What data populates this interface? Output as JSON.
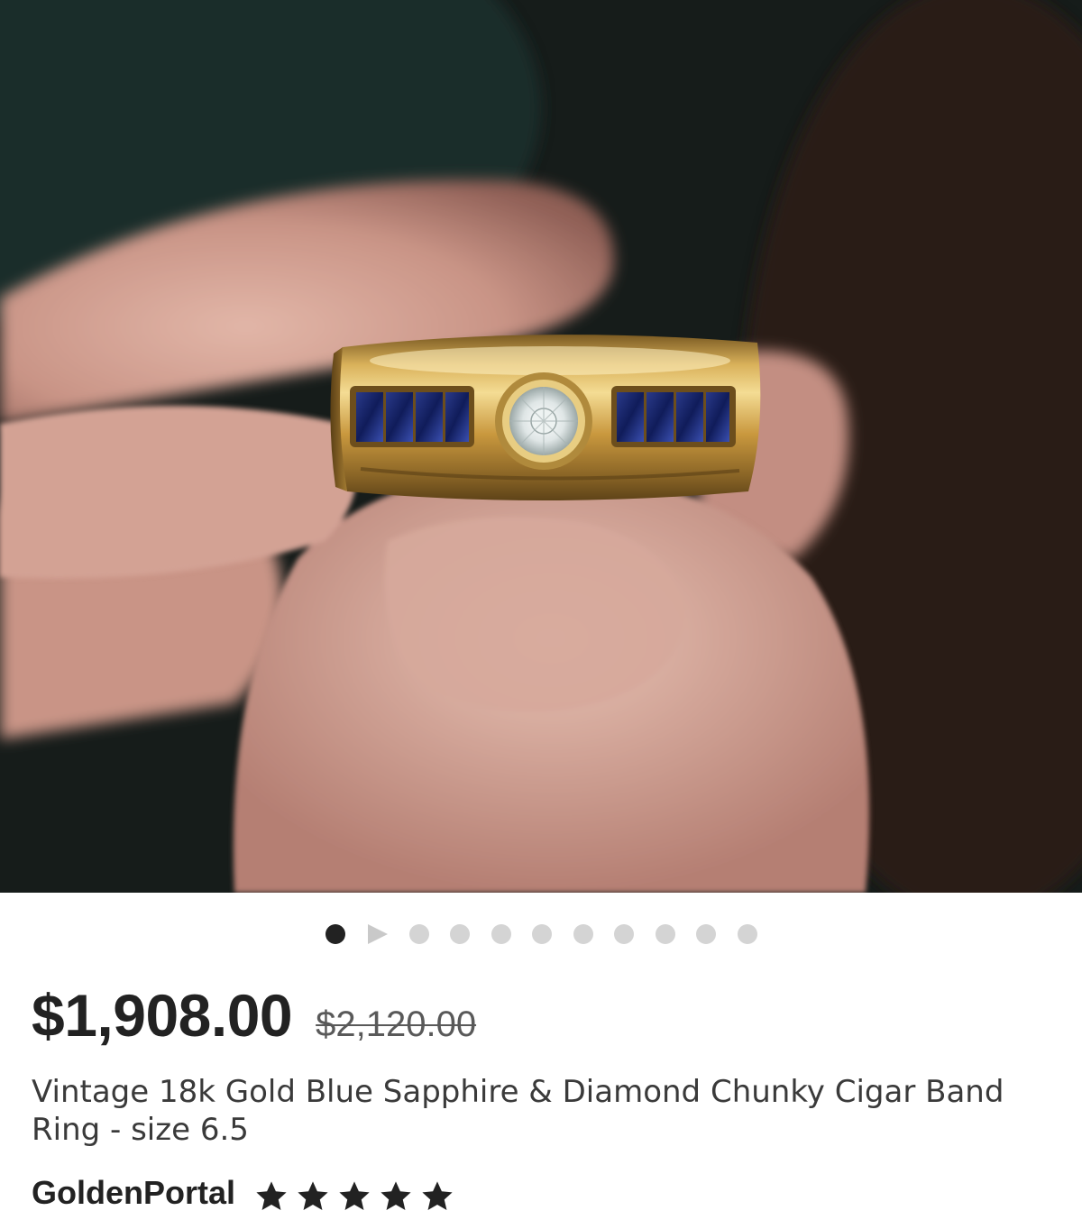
{
  "listing": {
    "price": "$1,908.00",
    "original_price": "$2,120.00",
    "title": "Vintage 18k Gold Blue Sapphire & Diamond Chunky Cigar Band Ring - size 6.5",
    "shop_name": "GoldenPortal",
    "rating": 5,
    "rating_max": 5
  },
  "carousel": {
    "total_slides": 11,
    "active_index": 0,
    "video_slide_index": 1
  },
  "colors": {
    "price": "#222222",
    "old_price": "#595959",
    "dot_active": "#222222",
    "dot_inactive": "#d4d4d4",
    "star": "#222222"
  },
  "icons": {
    "star": "star-icon",
    "video_slide": "play-icon"
  }
}
